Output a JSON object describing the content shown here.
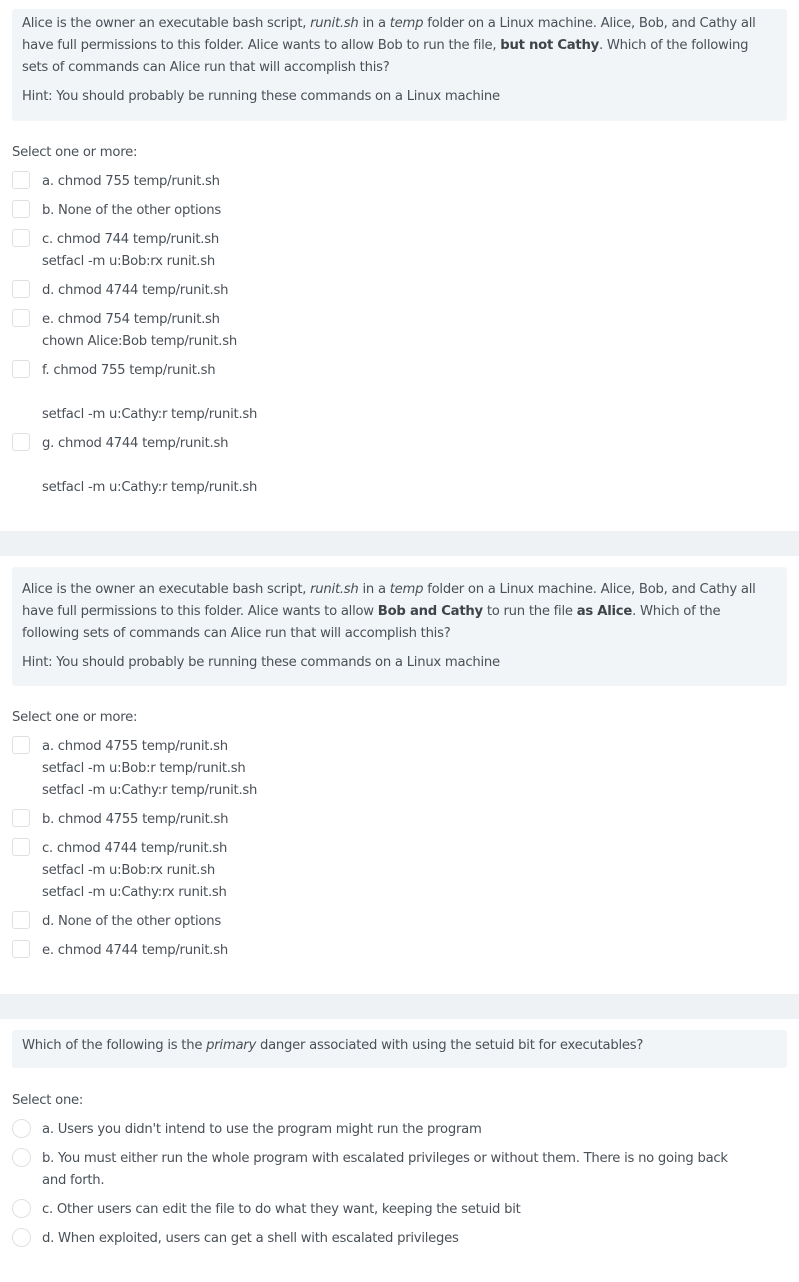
{
  "questions": [
    {
      "text_lines": [
        [
          "Alice is the owner an executable bash script, ",
          {
            "i": "runit.sh"
          },
          " in a ",
          {
            "i": "temp"
          },
          " folder on a Linux machine. Alice, Bob, and Cathy all"
        ],
        [
          "have full permissions to this folder. Alice wants to allow Bob to run the file, ",
          {
            "b": "but not Cathy"
          },
          ". Which of the following"
        ],
        [
          "sets of commands can Alice run that will accomplish this?"
        ]
      ],
      "hint": "Hint: You should probably be running these commands on a Linux machine",
      "prompt": "Select one or more:",
      "type": "checkbox",
      "options": [
        {
          "lines": [
            "a. chmod 755 temp/runit.sh"
          ]
        },
        {
          "lines": [
            "b. None of the other options"
          ]
        },
        {
          "lines": [
            "c. chmod 744 temp/runit.sh",
            "setfacl -m u:Bob:rx runit.sh"
          ]
        },
        {
          "lines": [
            "d. chmod 4744 temp/runit.sh"
          ]
        },
        {
          "lines": [
            "e. chmod 754 temp/runit.sh",
            "chown Alice:Bob temp/runit.sh"
          ]
        },
        {
          "lines": [
            "f. chmod 755 temp/runit.sh",
            "",
            "setfacl -m u:Cathy:r temp/runit.sh"
          ]
        },
        {
          "lines": [
            "g. chmod 4744 temp/runit.sh",
            "",
            "setfacl -m u:Cathy:r temp/runit.sh"
          ]
        }
      ]
    },
    {
      "text_lines": [
        [
          "Alice is the owner an executable bash script, ",
          {
            "i": "runit.sh"
          },
          " in a ",
          {
            "i": "temp"
          },
          " folder on a Linux machine. Alice, Bob, and Cathy all"
        ],
        [
          "have full permissions to this folder. Alice wants to allow ",
          {
            "b": "Bob and Cathy"
          },
          " to run the file ",
          {
            "b": "as Alice"
          },
          ". Which of the"
        ],
        [
          "following sets of commands can Alice run that will accomplish this?"
        ]
      ],
      "hint": "Hint: You should probably be running these commands on a Linux machine",
      "prompt": "Select one or more:",
      "type": "checkbox",
      "options": [
        {
          "lines": [
            "a. chmod 4755 temp/runit.sh",
            "setfacl -m u:Bob:r temp/runit.sh",
            "setfacl -m u:Cathy:r temp/runit.sh"
          ]
        },
        {
          "lines": [
            "b. chmod 4755 temp/runit.sh"
          ]
        },
        {
          "lines": [
            "c. chmod 4744 temp/runit.sh",
            "setfacl -m u:Bob:rx runit.sh",
            "setfacl -m u:Cathy:rx runit.sh"
          ]
        },
        {
          "lines": [
            "d. None of the other options"
          ]
        },
        {
          "lines": [
            "e. chmod 4744 temp/runit.sh"
          ]
        }
      ]
    },
    {
      "text_lines": [
        [
          "Which of the following is the ",
          {
            "i": "primary"
          },
          " danger associated with using the setuid bit for executables?"
        ]
      ],
      "hint": null,
      "prompt": "Select one:",
      "type": "radio",
      "options": [
        {
          "lines": [
            "a. Users you didn't intend to use the program might run the program"
          ]
        },
        {
          "lines": [
            "b. You must either run the whole program with escalated privileges or without them. There is no going back",
            "and forth."
          ]
        },
        {
          "lines": [
            "c. Other users can edit the file to do what they want, keeping the setuid bit"
          ]
        },
        {
          "lines": [
            "d. When exploited, users can get a shell with escalated privileges"
          ]
        }
      ]
    }
  ]
}
